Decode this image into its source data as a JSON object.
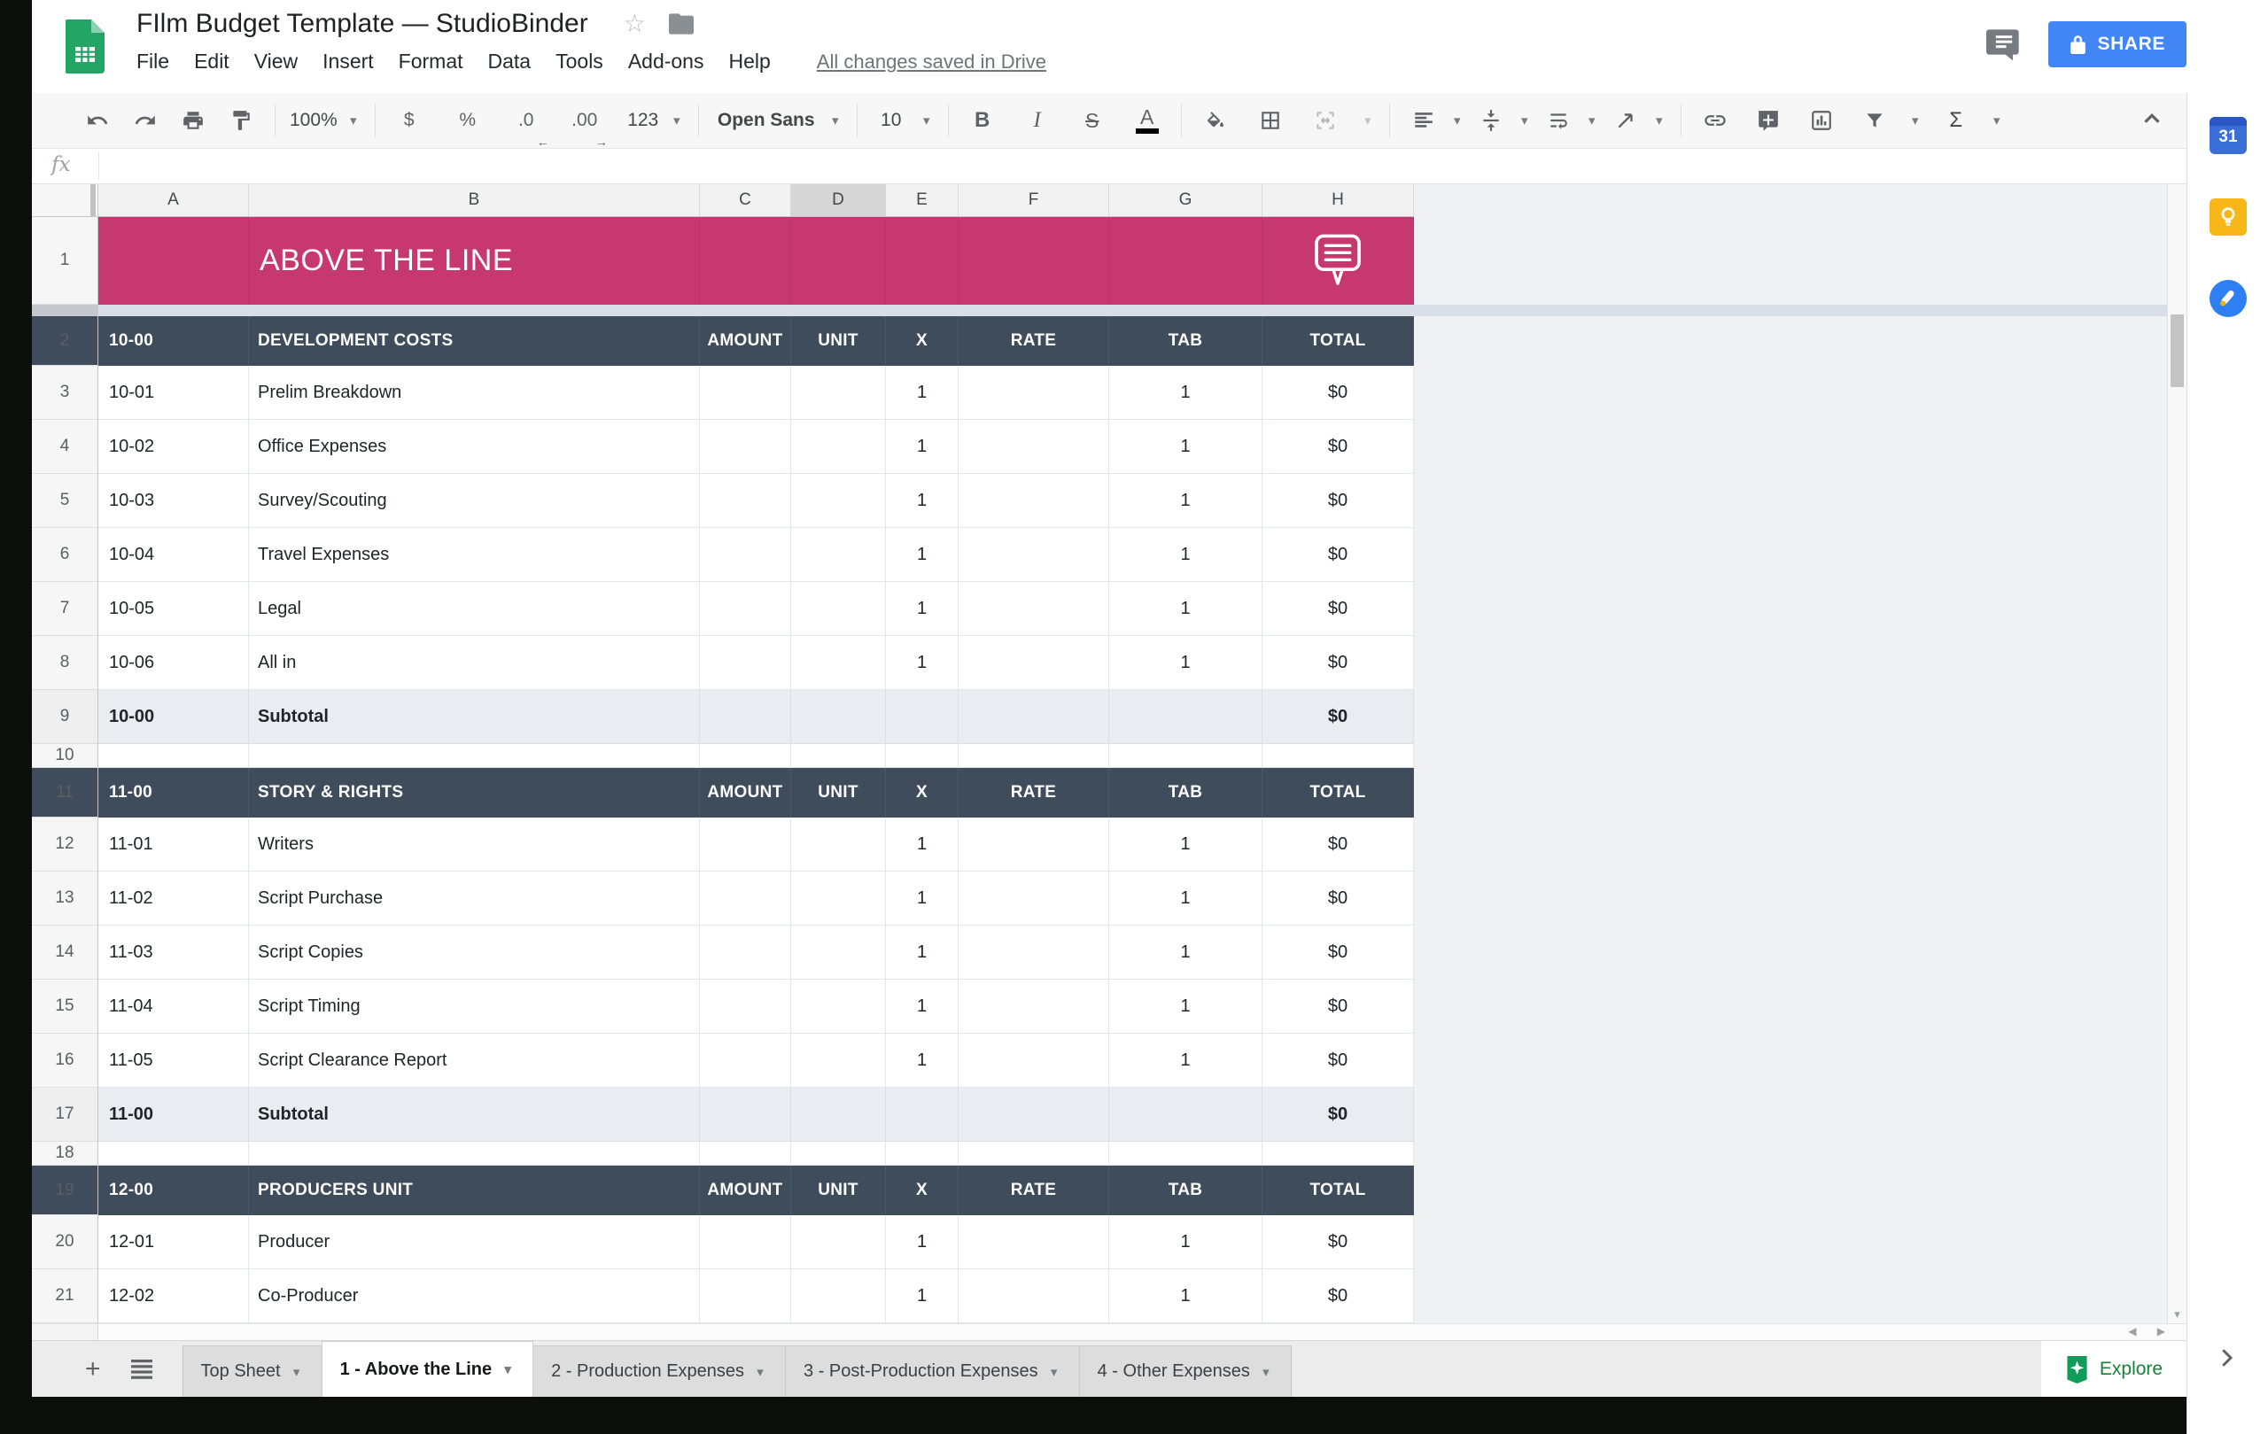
{
  "colors": {
    "banner_pink": "#C73770",
    "section_header_slate": "#3E4C5B",
    "share_blue": "#4285F4",
    "explore_green": "#188038",
    "brand_avatar_pink": "#E8486F",
    "sheets_green": "#23A566"
  },
  "titlebar": {
    "doc_title": "FIlm Budget Template — StudioBinder",
    "menus": [
      {
        "label": "File"
      },
      {
        "label": "Edit"
      },
      {
        "label": "View"
      },
      {
        "label": "Insert"
      },
      {
        "label": "Format"
      },
      {
        "label": "Data"
      },
      {
        "label": "Tools"
      },
      {
        "label": "Add-ons"
      },
      {
        "label": "Help"
      }
    ],
    "save_status": "All changes saved in Drive",
    "share_label": "SHARE"
  },
  "toolbar": {
    "zoom_level": "100%",
    "currency": "$",
    "percent": "%",
    "decrease_decimal": ".0",
    "increase_decimal": ".00",
    "more_formats": "123",
    "font_name": "Open Sans",
    "font_size": "10",
    "bold": "B",
    "italic": "I",
    "strikethrough": "S",
    "text_color": "A",
    "functions": "Σ"
  },
  "formula_bar": {
    "fx_label": "fx",
    "value": ""
  },
  "grid": {
    "selected_column": "D",
    "columns": [
      {
        "letter": "A"
      },
      {
        "letter": "B"
      },
      {
        "letter": "C"
      },
      {
        "letter": "D"
      },
      {
        "letter": "E"
      },
      {
        "letter": "F"
      },
      {
        "letter": "G"
      },
      {
        "letter": "H"
      }
    ],
    "banner": {
      "row_number": "1",
      "title": "ABOVE THE LINE"
    },
    "rows": [
      {
        "n": "2",
        "type": "section",
        "code": "10-00",
        "desc": "DEVELOPMENT COSTS",
        "amount": "AMOUNT",
        "unit": "UNIT",
        "x": "X",
        "rate": "RATE",
        "tab": "TAB",
        "total": "TOTAL"
      },
      {
        "n": "3",
        "type": "data",
        "code": "10-01",
        "desc": "Prelim Breakdown",
        "x": "1",
        "tab": "1",
        "total": "$0"
      },
      {
        "n": "4",
        "type": "data",
        "code": "10-02",
        "desc": "Office Expenses",
        "x": "1",
        "tab": "1",
        "total": "$0"
      },
      {
        "n": "5",
        "type": "data",
        "code": "10-03",
        "desc": "Survey/Scouting",
        "x": "1",
        "tab": "1",
        "total": "$0"
      },
      {
        "n": "6",
        "type": "data",
        "code": "10-04",
        "desc": "Travel Expenses",
        "x": "1",
        "tab": "1",
        "total": "$0"
      },
      {
        "n": "7",
        "type": "data",
        "code": "10-05",
        "desc": "Legal",
        "x": "1",
        "tab": "1",
        "total": "$0"
      },
      {
        "n": "8",
        "type": "data",
        "code": "10-06",
        "desc": "All in",
        "x": "1",
        "tab": "1",
        "total": "$0"
      },
      {
        "n": "9",
        "type": "subtotal",
        "code": "10-00",
        "desc": "Subtotal",
        "total": "$0"
      },
      {
        "n": "10",
        "type": "spacer"
      },
      {
        "n": "11",
        "type": "section",
        "code": "11-00",
        "desc": "STORY & RIGHTS",
        "amount": "AMOUNT",
        "unit": "UNIT",
        "x": "X",
        "rate": "RATE",
        "tab": "TAB",
        "total": "TOTAL"
      },
      {
        "n": "12",
        "type": "data",
        "code": "11-01",
        "desc": "Writers",
        "x": "1",
        "tab": "1",
        "total": "$0"
      },
      {
        "n": "13",
        "type": "data",
        "code": "11-02",
        "desc": "Script Purchase",
        "x": "1",
        "tab": "1",
        "total": "$0"
      },
      {
        "n": "14",
        "type": "data",
        "code": "11-03",
        "desc": "Script Copies",
        "x": "1",
        "tab": "1",
        "total": "$0"
      },
      {
        "n": "15",
        "type": "data",
        "code": "11-04",
        "desc": "Script Timing",
        "x": "1",
        "tab": "1",
        "total": "$0"
      },
      {
        "n": "16",
        "type": "data",
        "code": "11-05",
        "desc": "Script Clearance Report",
        "x": "1",
        "tab": "1",
        "total": "$0"
      },
      {
        "n": "17",
        "type": "subtotal",
        "code": "11-00",
        "desc": "Subtotal",
        "total": "$0"
      },
      {
        "n": "18",
        "type": "spacer"
      },
      {
        "n": "19",
        "type": "section",
        "code": "12-00",
        "desc": "PRODUCERS UNIT",
        "amount": "AMOUNT",
        "unit": "UNIT",
        "x": "X",
        "rate": "RATE",
        "tab": "TAB",
        "total": "TOTAL"
      },
      {
        "n": "20",
        "type": "data",
        "code": "12-01",
        "desc": "Producer",
        "x": "1",
        "tab": "1",
        "total": "$0"
      },
      {
        "n": "21",
        "type": "data",
        "code": "12-02",
        "desc": "Co-Producer",
        "x": "1",
        "tab": "1",
        "total": "$0"
      }
    ]
  },
  "sheet_tabs": {
    "tabs": [
      {
        "label": "Top Sheet"
      },
      {
        "label": "1 - Above the Line",
        "active": true
      },
      {
        "label": "2 - Production Expenses"
      },
      {
        "label": "3 - Post-Production Expenses"
      },
      {
        "label": "4 - Other Expenses"
      }
    ]
  },
  "explore": {
    "label": "Explore"
  },
  "side_panel": {
    "calendar_label": "31"
  }
}
